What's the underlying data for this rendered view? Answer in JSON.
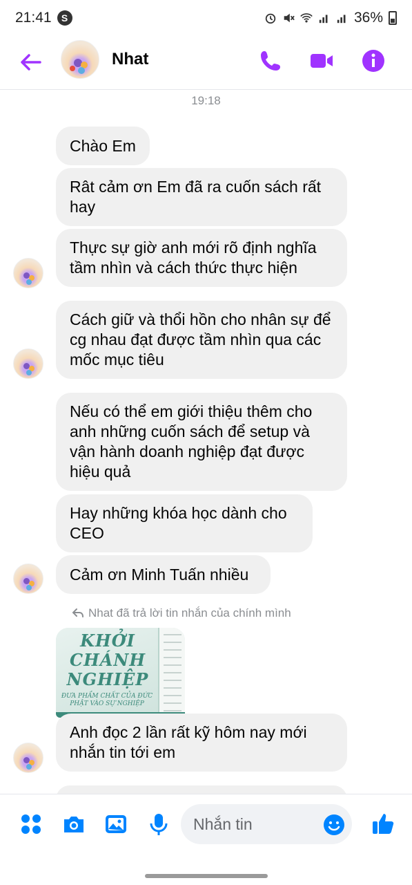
{
  "status_bar": {
    "time": "21:41",
    "battery": "36%"
  },
  "header": {
    "contact_name": "Nhat"
  },
  "chat": {
    "timestamp": "19:18",
    "messages": [
      "Chào Em",
      "Rât cảm ơn Em đã ra cuốn sách rất hay",
      "Thực sự giờ anh mới rõ định nghĩa tầm nhìn và cách thức thực hiện",
      "Cách giữ và thổi hồn cho nhân sự để cg nhau đạt được tầm nhìn qua các mốc mục tiêu",
      "Nếu có thể em giới thiệu thêm cho anh những cuốn sách để setup và vận hành doanh nghiệp đạt được hiệu quả",
      "Hay những khóa học dành cho CEO",
      "Cảm ơn Minh Tuấn nhiều",
      "Anh đọc 2 lần rất kỹ hôm nay mới nhắn tin tới em"
    ],
    "reply_note": "Nhat đã trả lời tin nhắn của chính mình",
    "photo": {
      "title_line1": "KHỞI",
      "title_line2": "CHÁNH",
      "title_line3": "NGHIỆP",
      "subtitle": "ĐƯA PHẨM CHẤT CỦA ĐỨC PHẬT VÀO SỰ NGHIỆP"
    }
  },
  "composer": {
    "placeholder": "Nhắn tin"
  },
  "colors": {
    "accent": "#a033ff",
    "blue": "#0084ff",
    "bubble": "#f0f0f0"
  }
}
